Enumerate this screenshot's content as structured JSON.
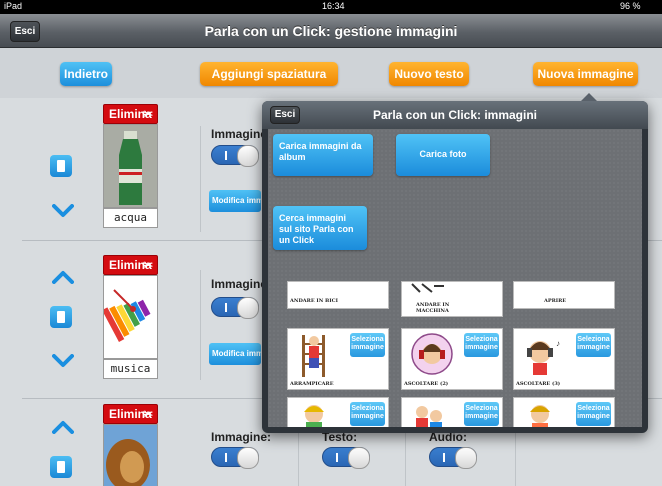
{
  "status": {
    "device": "iPad",
    "time": "16:34",
    "battery": "96 %"
  },
  "header": {
    "title": "Parla con un Click: gestione immagini",
    "exit_label": "Esci"
  },
  "toolbar": {
    "back": "Indietro",
    "add_spacing": "Aggiungi spaziatura",
    "new_text": "Nuovo testo",
    "new_image": "Nuova immagine"
  },
  "rows": [
    {
      "delete_label": "Elimina",
      "caption": "acqua",
      "image_label": "Immagine:",
      "edit_label": "Modifica immagine"
    },
    {
      "delete_label": "Elimina",
      "caption": "musica",
      "image_label": "Immagine:",
      "edit_label": "Modifica immagine"
    },
    {
      "delete_label": "Elimina",
      "caption": "",
      "image_label": "Immagine:",
      "text_label": "Testo:",
      "audio_label": "Audio:"
    }
  ],
  "popover": {
    "title": "Parla con un Click: immagini",
    "exit_label": "Esci",
    "load_album": "Carica immagini da album",
    "load_photo": "Carica foto",
    "search_site": "Cerca immagini sul sito Parla con un Click",
    "partial_cards": [
      "ANDARE IN BICI",
      "ANDARE IN MACCHINA",
      "APRIRE"
    ],
    "cards": [
      {
        "caption": "ARRAMPICARE",
        "select": "Seleziona immagine"
      },
      {
        "caption": "ASCOLTARE (2)",
        "select": "Seleziona immagine"
      },
      {
        "caption": "ASCOLTARE (3)",
        "select": "Seleziona immagine"
      },
      {
        "caption": "",
        "select": "Seleziona immagine"
      },
      {
        "caption": "",
        "select": "Seleziona immagine"
      },
      {
        "caption": "",
        "select": "Seleziona immagine"
      }
    ]
  },
  "colors": {
    "blue": "#1d8fdc",
    "orange": "#f08700",
    "delete_red": "#d40b10"
  }
}
